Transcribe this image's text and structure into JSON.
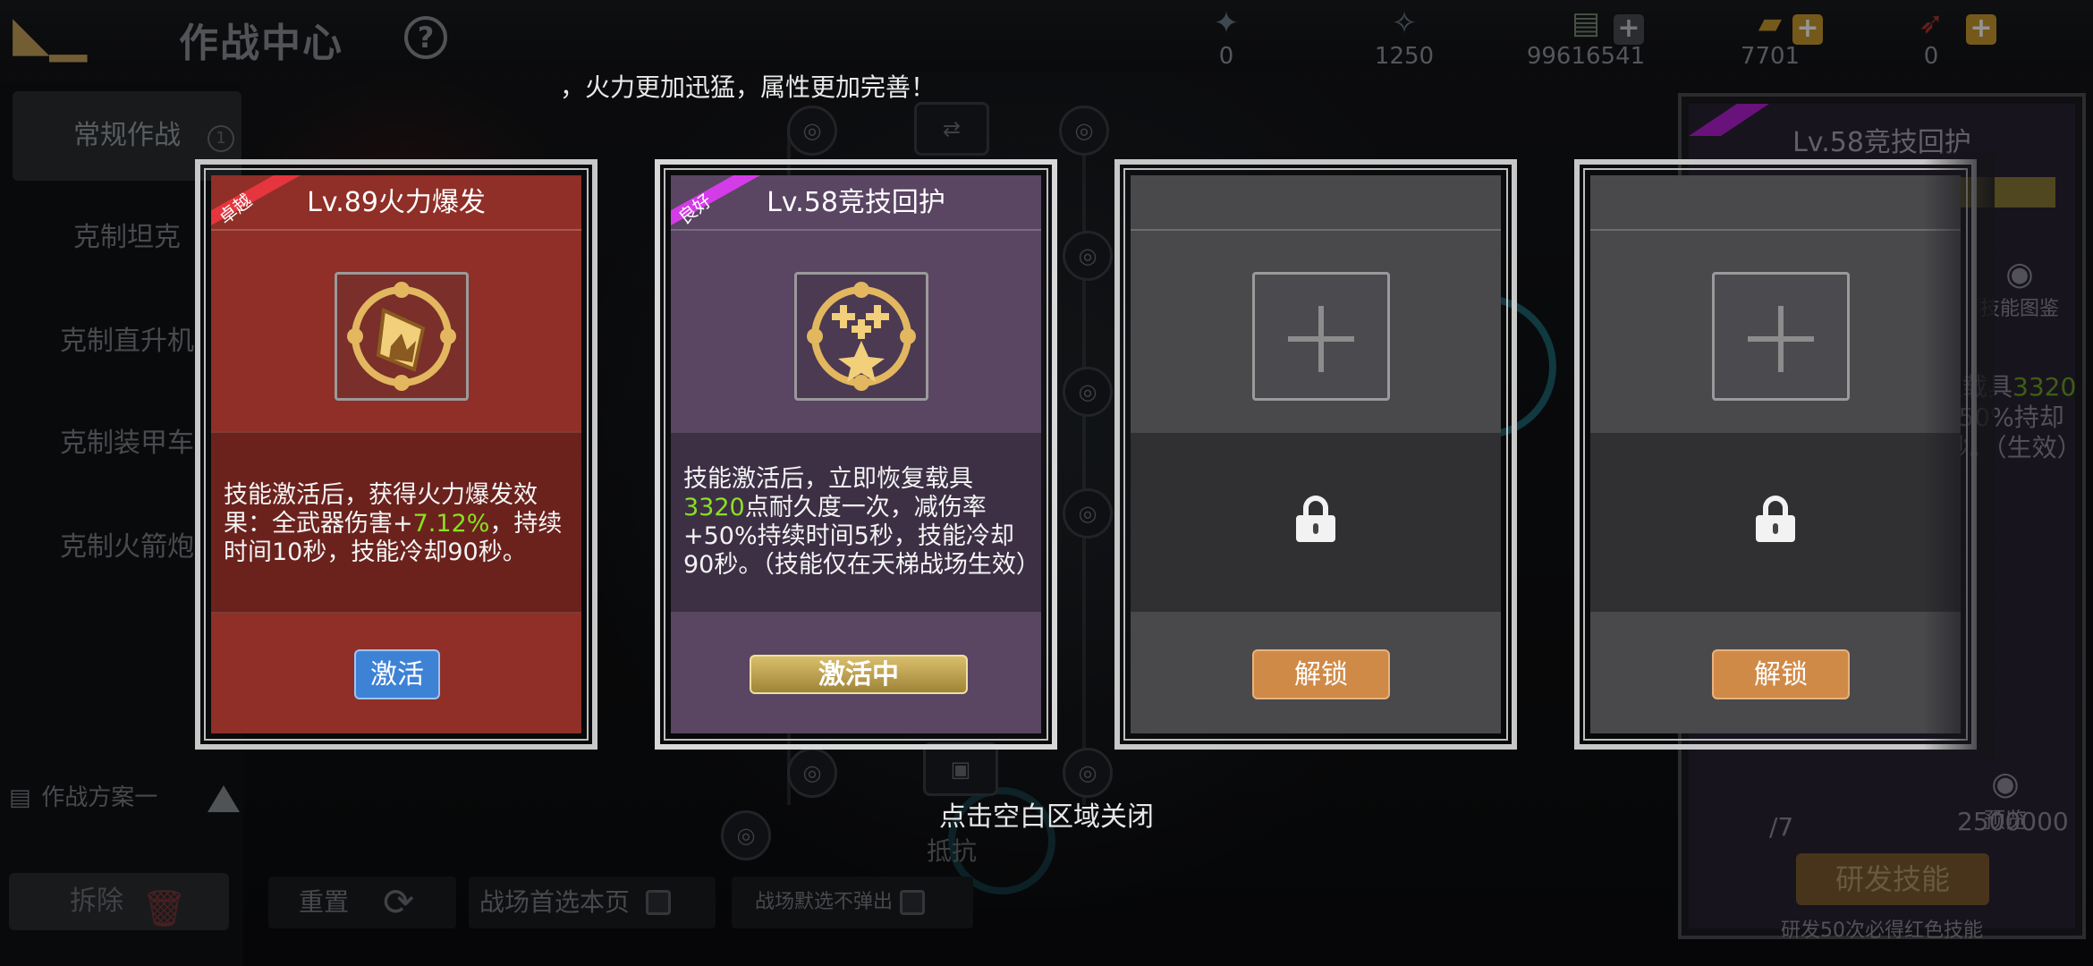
{
  "topbar": {
    "title": "作战中心",
    "help_icon": "?",
    "resources": [
      {
        "icon": "medal-icon",
        "value": "0",
        "has_plus": false
      },
      {
        "icon": "star-badge-icon",
        "value": "1250",
        "has_plus": false
      },
      {
        "icon": "cash-icon",
        "value": "99616541",
        "has_plus": true
      },
      {
        "icon": "gold-bar-icon",
        "value": "7701",
        "has_plus": true
      },
      {
        "icon": "rocket-icon",
        "value": "0",
        "has_plus": true
      }
    ]
  },
  "sidebar": {
    "items": [
      {
        "label": "常规作战",
        "badge": "1"
      },
      {
        "label": "克制坦克"
      },
      {
        "label": "克制直升机"
      },
      {
        "label": "克制装甲车"
      },
      {
        "label": "克制火箭炮"
      }
    ],
    "plan_label": "作战方案一",
    "remove_label": "拆除"
  },
  "bottom": {
    "reset_label": "重置",
    "first_page_label": "战场首选本页",
    "no_popup_label": "战场默选不弹出",
    "resist_label": "抵抗"
  },
  "banner": "，火力更加迅猛，属性更加完善！",
  "close_hint": "点击空白区域关闭",
  "cards": [
    {
      "tag": "卓越",
      "title": "Lv.89火力爆发",
      "desc_parts": [
        "技能激活后，获得火力爆发效果：全武器伤害+",
        "7.12%",
        "，持续时间10秒，技能冷却90秒。"
      ],
      "button": "激活",
      "colors": {
        "face": "#8f2f27",
        "desc": "#6b221d",
        "tag": "#e5353e",
        "button": "#3e82d6"
      }
    },
    {
      "tag": "良好",
      "title": "Lv.58竞技回护",
      "desc_parts": [
        "技能激活后，立即恢复载具",
        "3320",
        "点耐久度一次，减伤率+50%持续时间5秒，技能冷却90秒。（技能仅在天梯战场生效）"
      ],
      "button": "激活中",
      "colors": {
        "face": "#5a4563",
        "desc": "#3d3045",
        "tag": "#d43ce8",
        "button": "#c6a84e"
      }
    },
    {
      "title": "",
      "button": "解锁",
      "locked": true,
      "colors": {
        "face": "#49494c",
        "desc": "#303033",
        "button": "#d08a48"
      }
    },
    {
      "title": "",
      "button": "解锁",
      "locked": true,
      "colors": {
        "face": "#49494c",
        "desc": "#303033",
        "button": "#d08a48"
      }
    }
  ],
  "right_panel": {
    "title": "Lv.58竞技回护",
    "skill_gallery": "技能图鉴",
    "desc_parts": [
      "恢复载具",
      "3320",
      "率+50%持却90秒。（生效）"
    ],
    "preview": "预览",
    "count": "/7",
    "money": "2500000",
    "research_button": "研发技能",
    "note": "研发50次必得红色技能"
  }
}
